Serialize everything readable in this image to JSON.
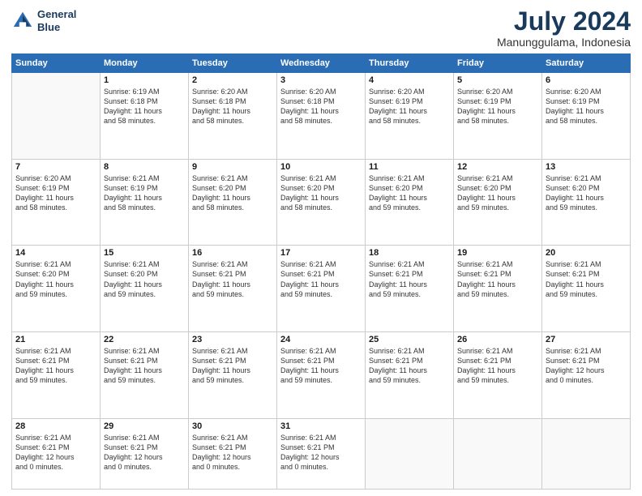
{
  "header": {
    "logo_line1": "General",
    "logo_line2": "Blue",
    "month": "July 2024",
    "location": "Manunggulama, Indonesia"
  },
  "weekdays": [
    "Sunday",
    "Monday",
    "Tuesday",
    "Wednesday",
    "Thursday",
    "Friday",
    "Saturday"
  ],
  "weeks": [
    [
      {
        "day": "",
        "info": ""
      },
      {
        "day": "1",
        "info": "Sunrise: 6:19 AM\nSunset: 6:18 PM\nDaylight: 11 hours\nand 58 minutes."
      },
      {
        "day": "2",
        "info": "Sunrise: 6:20 AM\nSunset: 6:18 PM\nDaylight: 11 hours\nand 58 minutes."
      },
      {
        "day": "3",
        "info": "Sunrise: 6:20 AM\nSunset: 6:18 PM\nDaylight: 11 hours\nand 58 minutes."
      },
      {
        "day": "4",
        "info": "Sunrise: 6:20 AM\nSunset: 6:19 PM\nDaylight: 11 hours\nand 58 minutes."
      },
      {
        "day": "5",
        "info": "Sunrise: 6:20 AM\nSunset: 6:19 PM\nDaylight: 11 hours\nand 58 minutes."
      },
      {
        "day": "6",
        "info": "Sunrise: 6:20 AM\nSunset: 6:19 PM\nDaylight: 11 hours\nand 58 minutes."
      }
    ],
    [
      {
        "day": "7",
        "info": "Sunrise: 6:20 AM\nSunset: 6:19 PM\nDaylight: 11 hours\nand 58 minutes."
      },
      {
        "day": "8",
        "info": "Sunrise: 6:21 AM\nSunset: 6:19 PM\nDaylight: 11 hours\nand 58 minutes."
      },
      {
        "day": "9",
        "info": "Sunrise: 6:21 AM\nSunset: 6:20 PM\nDaylight: 11 hours\nand 58 minutes."
      },
      {
        "day": "10",
        "info": "Sunrise: 6:21 AM\nSunset: 6:20 PM\nDaylight: 11 hours\nand 58 minutes."
      },
      {
        "day": "11",
        "info": "Sunrise: 6:21 AM\nSunset: 6:20 PM\nDaylight: 11 hours\nand 59 minutes."
      },
      {
        "day": "12",
        "info": "Sunrise: 6:21 AM\nSunset: 6:20 PM\nDaylight: 11 hours\nand 59 minutes."
      },
      {
        "day": "13",
        "info": "Sunrise: 6:21 AM\nSunset: 6:20 PM\nDaylight: 11 hours\nand 59 minutes."
      }
    ],
    [
      {
        "day": "14",
        "info": "Sunrise: 6:21 AM\nSunset: 6:20 PM\nDaylight: 11 hours\nand 59 minutes."
      },
      {
        "day": "15",
        "info": "Sunrise: 6:21 AM\nSunset: 6:20 PM\nDaylight: 11 hours\nand 59 minutes."
      },
      {
        "day": "16",
        "info": "Sunrise: 6:21 AM\nSunset: 6:21 PM\nDaylight: 11 hours\nand 59 minutes."
      },
      {
        "day": "17",
        "info": "Sunrise: 6:21 AM\nSunset: 6:21 PM\nDaylight: 11 hours\nand 59 minutes."
      },
      {
        "day": "18",
        "info": "Sunrise: 6:21 AM\nSunset: 6:21 PM\nDaylight: 11 hours\nand 59 minutes."
      },
      {
        "day": "19",
        "info": "Sunrise: 6:21 AM\nSunset: 6:21 PM\nDaylight: 11 hours\nand 59 minutes."
      },
      {
        "day": "20",
        "info": "Sunrise: 6:21 AM\nSunset: 6:21 PM\nDaylight: 11 hours\nand 59 minutes."
      }
    ],
    [
      {
        "day": "21",
        "info": "Sunrise: 6:21 AM\nSunset: 6:21 PM\nDaylight: 11 hours\nand 59 minutes."
      },
      {
        "day": "22",
        "info": "Sunrise: 6:21 AM\nSunset: 6:21 PM\nDaylight: 11 hours\nand 59 minutes."
      },
      {
        "day": "23",
        "info": "Sunrise: 6:21 AM\nSunset: 6:21 PM\nDaylight: 11 hours\nand 59 minutes."
      },
      {
        "day": "24",
        "info": "Sunrise: 6:21 AM\nSunset: 6:21 PM\nDaylight: 11 hours\nand 59 minutes."
      },
      {
        "day": "25",
        "info": "Sunrise: 6:21 AM\nSunset: 6:21 PM\nDaylight: 11 hours\nand 59 minutes."
      },
      {
        "day": "26",
        "info": "Sunrise: 6:21 AM\nSunset: 6:21 PM\nDaylight: 11 hours\nand 59 minutes."
      },
      {
        "day": "27",
        "info": "Sunrise: 6:21 AM\nSunset: 6:21 PM\nDaylight: 12 hours\nand 0 minutes."
      }
    ],
    [
      {
        "day": "28",
        "info": "Sunrise: 6:21 AM\nSunset: 6:21 PM\nDaylight: 12 hours\nand 0 minutes."
      },
      {
        "day": "29",
        "info": "Sunrise: 6:21 AM\nSunset: 6:21 PM\nDaylight: 12 hours\nand 0 minutes."
      },
      {
        "day": "30",
        "info": "Sunrise: 6:21 AM\nSunset: 6:21 PM\nDaylight: 12 hours\nand 0 minutes."
      },
      {
        "day": "31",
        "info": "Sunrise: 6:21 AM\nSunset: 6:21 PM\nDaylight: 12 hours\nand 0 minutes."
      },
      {
        "day": "",
        "info": ""
      },
      {
        "day": "",
        "info": ""
      },
      {
        "day": "",
        "info": ""
      }
    ]
  ]
}
